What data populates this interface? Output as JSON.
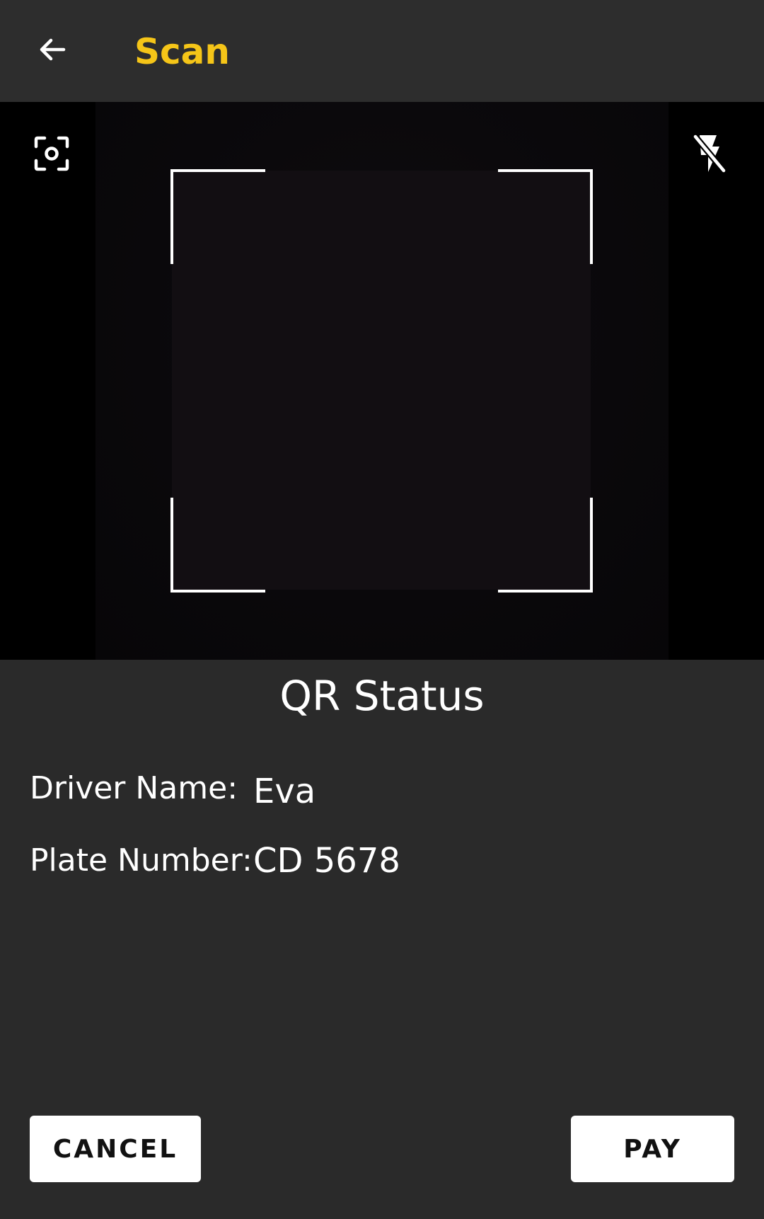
{
  "app_bar": {
    "title": "Scan",
    "title_color": "#f5c518",
    "back_icon": "arrow-left-icon"
  },
  "camera": {
    "focus_icon": "focus-icon",
    "flash_icon": "flash-off-icon"
  },
  "qr_status": {
    "title": "QR Status",
    "driver_name_label": "Driver Name:",
    "driver_name_value": "Eva",
    "plate_number_label": "Plate Number:",
    "plate_number_value": "CD 5678"
  },
  "actions": {
    "cancel_label": "CANCEL",
    "pay_label": "PAY"
  }
}
